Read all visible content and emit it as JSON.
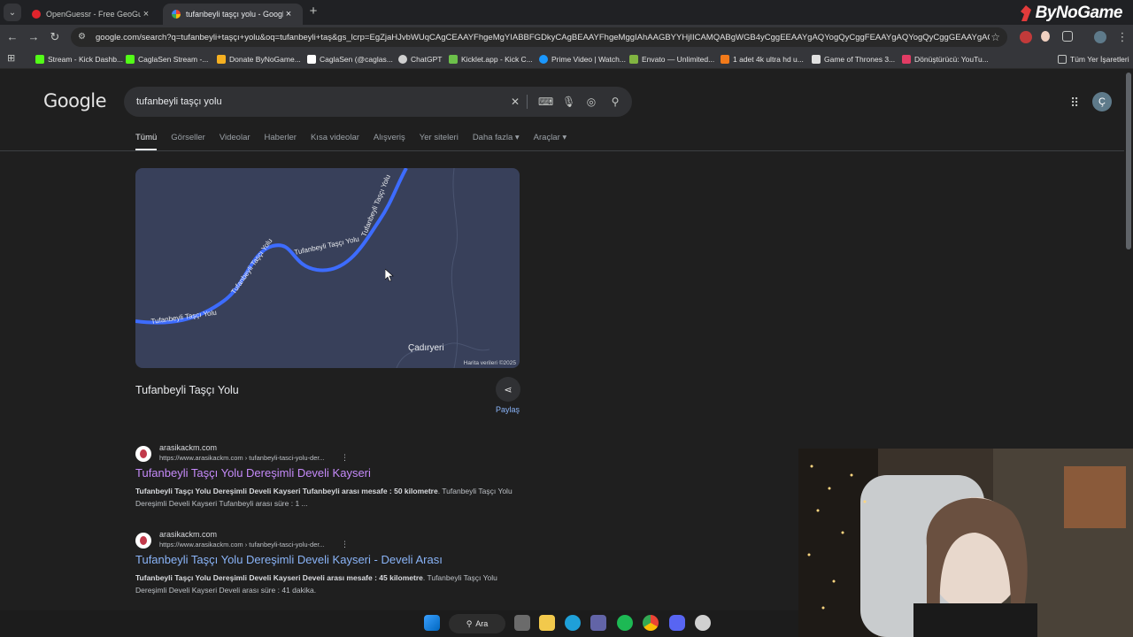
{
  "browser": {
    "tabs": [
      {
        "title": "OpenGuessr - Free GeoGuessr Alternative",
        "favicon": "opera-icon",
        "active": false
      },
      {
        "title": "tufanbeyli taşçı yolu - Google'da Ara",
        "favicon": "google-icon",
        "active": true
      }
    ],
    "new_tab_label": "+",
    "brand": "ByNoGame",
    "url": "google.com/search?q=tufanbeyli+taşçı+yolu&oq=tufanbeyli+taş&gs_lcrp=EgZjaHJvbWUqCAgCEAAYFhgeMgYIABBFGDkyCAgBEAAYFhgeMggIAhAAGBYYHjIICAMQABgWGB4yCggEEAAYgAQYogQyCggFEAAYgAQYogQyCggGEAAYgAQYogQyBw..."
  },
  "bookmarks": [
    {
      "label": "Stream - Kick Dashb...",
      "icon": "kick-icon",
      "color": "#53fc18"
    },
    {
      "label": "CaglaSen Stream -...",
      "icon": "kick-icon",
      "color": "#53fc18"
    },
    {
      "label": "Donate ByNoGame...",
      "icon": "donate-icon",
      "color": "#f5b021"
    },
    {
      "label": "CaglaSen (@caglas...",
      "icon": "tiktok-icon",
      "color": "#ffffff"
    },
    {
      "label": "ChatGPT",
      "icon": "chatgpt-icon",
      "color": "#d0d0d0"
    },
    {
      "label": "Kicklet.app - Kick C...",
      "icon": "kicklet-icon",
      "color": "#6cc04a"
    },
    {
      "label": "Prime Video | Watch...",
      "icon": "prime-icon",
      "color": "#1a98ff"
    },
    {
      "label": "Envato — Unlimited...",
      "icon": "envato-icon",
      "color": "#81b441"
    },
    {
      "label": "1 adet 4k ultra hd u...",
      "icon": "shop-icon",
      "color": "#f27a1a"
    },
    {
      "label": "Game of Thrones 3...",
      "icon": "got-icon",
      "color": "#e0e0e0"
    },
    {
      "label": "Dönüştürücü: YouTu...",
      "icon": "converter-icon",
      "color": "#e23c64"
    }
  ],
  "all_bookmarks_label": "Tüm Yer İşaretleri",
  "google": {
    "logo": "Google",
    "query": "tufanbeyli taşçı yolu",
    "avatar_letter": "Ç",
    "tabs": [
      "Tümü",
      "Görseller",
      "Videolar",
      "Haberler",
      "Kısa videolar",
      "Alışveriş",
      "Yer siteleri",
      "Daha fazla",
      "Araçlar"
    ]
  },
  "map": {
    "road_label": "Tufanbeyli Taşçı Yolu",
    "place_label": "Çadıryeri",
    "attribution": "Harita verileri ©2025",
    "road_color": "#3d6cff",
    "bg_color": "#38405a"
  },
  "place": {
    "title": "Tufanbeyli Taşçı Yolu",
    "share_label": "Paylaş"
  },
  "results": [
    {
      "site": "arasikackm.com",
      "url": "https://www.arasikackm.com › tufanbeyli-tasci-yolu-der...",
      "title": "Tufanbeyli Taşçı Yolu Dereşimli Develi Kayseri",
      "visited": true,
      "snippet_bold": "Tufanbeyli Taşçı Yolu Dereşimli Develi Kayseri Tufanbeyli arası mesafe : 50 kilometre",
      "snippet_rest": ". Tufanbeyli Taşçı Yolu Dereşimli Develi Kayseri Tufanbeyli arası süre : 1 ..."
    },
    {
      "site": "arasikackm.com",
      "url": "https://www.arasikackm.com › tufanbeyli-tasci-yolu-der...",
      "title": "Tufanbeyli Taşçı Yolu Dereşimli Develi Kayseri - Develi Arası",
      "visited": false,
      "snippet_bold": "Tufanbeyli Taşçı Yolu Dereşimli Develi Kayseri Develi arası mesafe : 45 kilometre",
      "snippet_rest": ". Tufanbeyli Taşçı Yolu Dereşimli Develi Kayseri Develi arası süre : 41 dakika."
    }
  ],
  "taskbar": {
    "search_label": "Ara",
    "apps": [
      "windows-start-icon",
      "search-icon",
      "task-view-icon",
      "file-explorer-icon",
      "edge-icon",
      "teams-icon",
      "spotify-icon",
      "chrome-icon",
      "discord-icon",
      "steam-icon"
    ]
  },
  "colors": {
    "link": "#8ab4f8",
    "visited": "#c58af9"
  }
}
